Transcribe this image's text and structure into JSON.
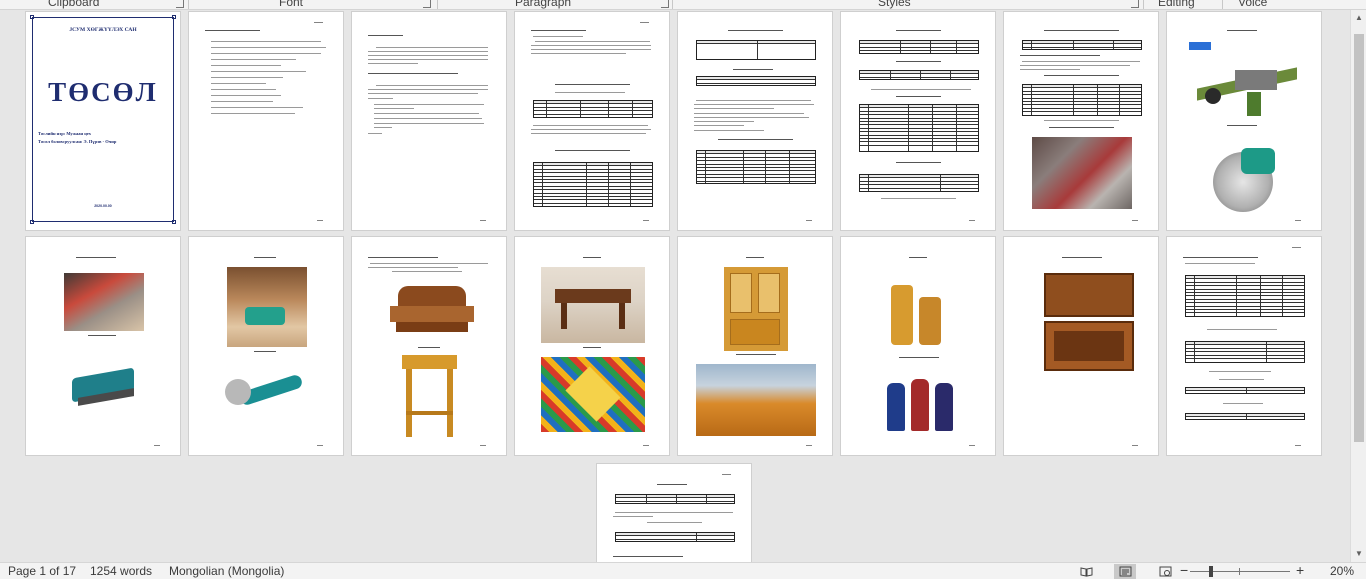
{
  "ribbon": {
    "groups": [
      "Clipboard",
      "Font",
      "Paragraph",
      "Styles",
      "Editing",
      "Voice"
    ]
  },
  "cover": {
    "org_name": "ЈСУМ ХӨГЖҮҮЛЭХ САН",
    "title": "ТӨСӨЛ",
    "subtitle1": "Төслийн нэр: Мужаан цех",
    "subtitle2": "Төсөл боловсруулсан: Э. Пүрэв - Очир",
    "date": "2020.00.00"
  },
  "statusbar": {
    "page": "Page 1 of 17",
    "words": "1254 words",
    "language": "Mongolian (Mongolia)",
    "zoom": "20%",
    "zoom_minus": "−",
    "zoom_plus": "+"
  },
  "icons": {
    "focus": "book-open-icon",
    "print_layout": "page-layout-icon",
    "web_layout": "globe-icon",
    "scroll_up": "chevron-up-icon",
    "scroll_down": "chevron-down-icon"
  },
  "colors": {
    "cover_blue": "#1f2d70",
    "background": "#e6e6e6",
    "status_bg": "#f3f3f3"
  }
}
